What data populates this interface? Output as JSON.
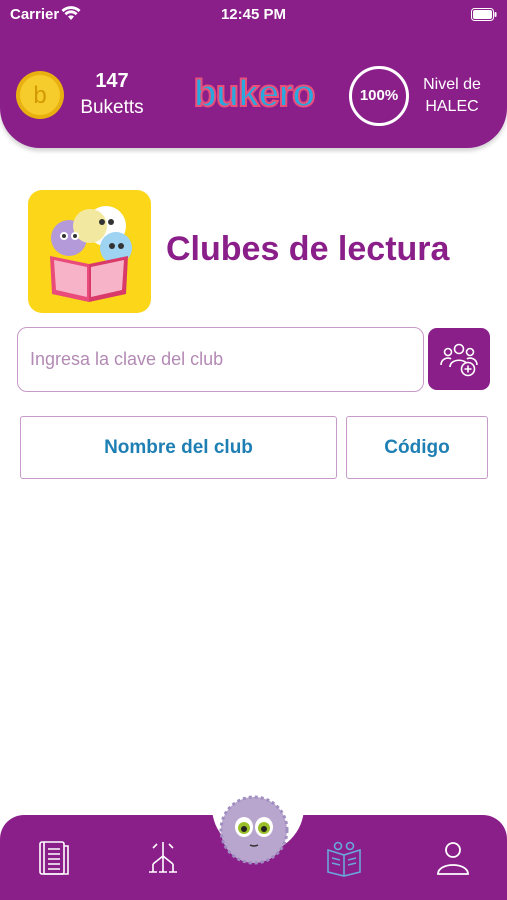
{
  "status_bar": {
    "carrier": "Carrier",
    "time": "12:45 PM"
  },
  "header": {
    "coins": "147",
    "coins_label": "Buketts",
    "logo_text": "bukero",
    "level_percent": "100%",
    "level_label_line1": "Nivel de",
    "level_label_line2": "HALEC"
  },
  "main": {
    "title": "Clubes de lectura",
    "input_placeholder": "Ingresa la clave del club",
    "input_value": "",
    "tabs": [
      {
        "label": "Nombre del club"
      },
      {
        "label": "Código"
      }
    ]
  },
  "bottom_nav": {
    "items": [
      {
        "icon": "books-icon"
      },
      {
        "icon": "tree-icon"
      },
      {
        "icon": "mascot-icon"
      },
      {
        "icon": "open-book-icon"
      },
      {
        "icon": "profile-icon"
      }
    ]
  },
  "colors": {
    "primary": "#8b1f8a",
    "accent_text": "#1e7fb4",
    "border": "#c89ac9",
    "coin": "#f2c21a"
  }
}
